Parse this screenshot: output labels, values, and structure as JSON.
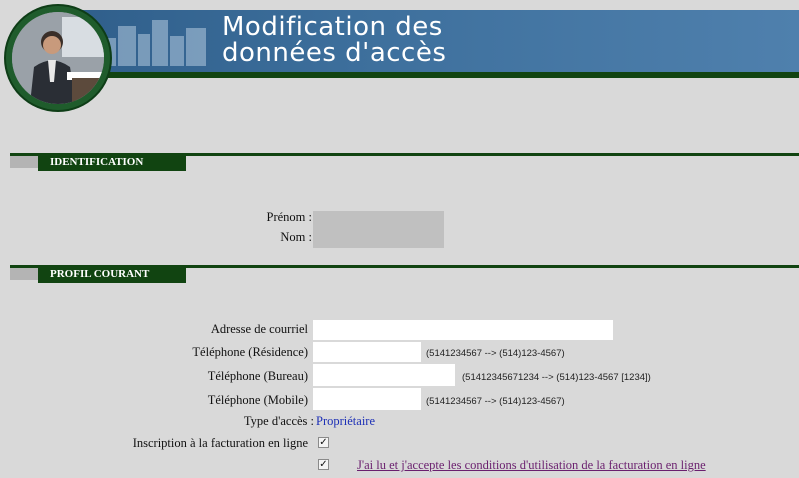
{
  "header": {
    "title_line1": "Modification des",
    "title_line2": "données d'accès"
  },
  "sections": {
    "identification": {
      "label": "IDENTIFICATION"
    },
    "profil": {
      "label": "PROFIL COURANT"
    }
  },
  "identification": {
    "prenom_label": "Prénom :",
    "nom_label": "Nom :"
  },
  "profil": {
    "email_label": "Adresse de courriel",
    "email_value": "",
    "tel_res_label": "Téléphone (Résidence)",
    "tel_res_value": "",
    "tel_res_hint": "(5141234567 --> (514)123-4567)",
    "tel_bur_label": "Téléphone (Bureau)",
    "tel_bur_value": "",
    "tel_bur_hint": "(51412345671234 --> (514)123-4567 [1234])",
    "tel_mob_label": "Téléphone (Mobile)",
    "tel_mob_value": "",
    "tel_mob_hint": "(5141234567 --> (514)123-4567)",
    "type_label": "Type d'accès :",
    "type_value": "Propriétaire",
    "inscription_label": "Inscription à la facturation en ligne",
    "inscription_checked": "✓",
    "conditions_checked": "✓",
    "conditions_link": "J'ai lu et j'accepte les conditions d'utilisation de la facturation en ligne"
  },
  "colors": {
    "background": "#d9d9d9",
    "dark_green": "#114411",
    "banner_blue": "#3d6f9c",
    "value_blue": "#1c2fb6",
    "link_purple": "#6a1f6e"
  },
  "icons": {
    "photo": "businessman-photo-icon",
    "buildings": "buildings-watermark-icon"
  }
}
